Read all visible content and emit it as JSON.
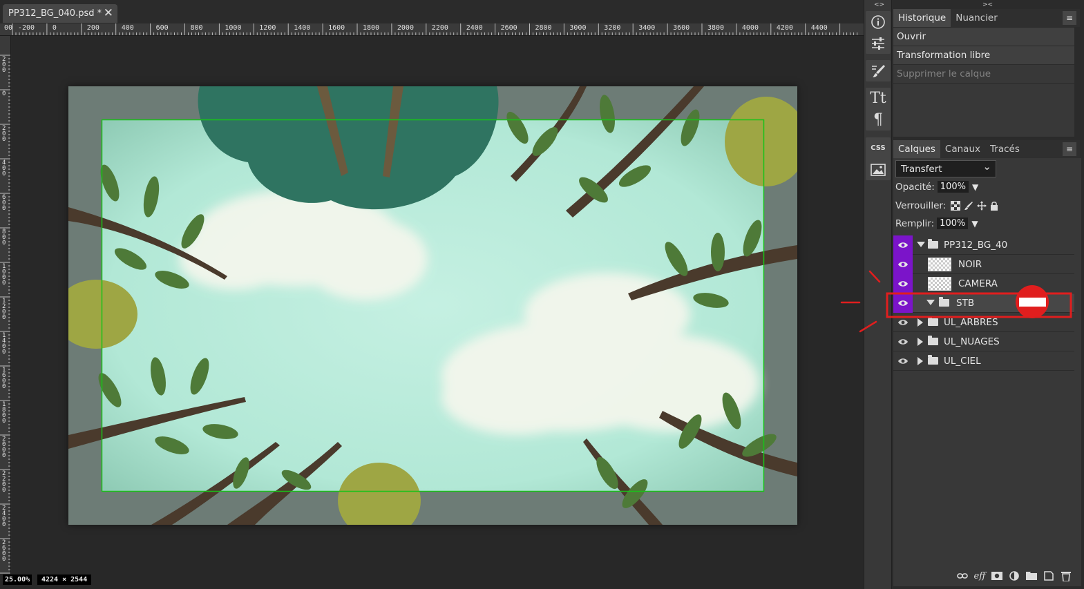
{
  "document_tab": {
    "title": "PP312_BG_040.psd *",
    "close_glyph": "✕"
  },
  "ruler_h": [
    "00",
    "-200",
    "0",
    "200",
    "400",
    "600",
    "800",
    "1000",
    "1200",
    "1400",
    "1600",
    "1800",
    "2000",
    "2200",
    "2400",
    "2600",
    "2800",
    "3000",
    "3200",
    "3400",
    "3600",
    "3800",
    "4000",
    "4200",
    "4400"
  ],
  "ruler_v": [
    "200",
    "0",
    "200",
    "400",
    "600",
    "800",
    "1000",
    "1200",
    "1400",
    "1600",
    "1800",
    "2000",
    "2200",
    "2400",
    "2600"
  ],
  "status": {
    "zoom": "25.00%",
    "dimensions": "4224 × 2544"
  },
  "tool_strip": {
    "collapse_glyph": "<>",
    "tools": [
      "info-icon",
      "adjustments-icon",
      "brush-settings-icon",
      "character-icon",
      "paragraph-icon",
      "css-icon",
      "image-icon"
    ],
    "css_label": "CSS"
  },
  "history_panel": {
    "collapse_glyph": "><",
    "tabs": [
      "Historique",
      "Nuancier"
    ],
    "menu_glyph": "≡",
    "items": [
      {
        "label": "Ouvrir",
        "state": "done"
      },
      {
        "label": "Transformation libre",
        "state": "done"
      },
      {
        "label": "Supprimer le calque",
        "state": "undone"
      }
    ]
  },
  "layers_panel": {
    "tabs": [
      "Calques",
      "Canaux",
      "Tracés"
    ],
    "menu_glyph": "≡",
    "blend_mode": "Transfert",
    "opacity_label": "Opacité:",
    "opacity_value": "100%",
    "lock_label": "Verrouiller:",
    "fill_label": "Remplir:",
    "fill_value": "100%",
    "layers": [
      {
        "name": "PP312_BG_40",
        "type": "group",
        "expanded": true,
        "highlight": true
      },
      {
        "name": "NOIR",
        "type": "layer",
        "highlight": true
      },
      {
        "name": "CAMERA",
        "type": "layer",
        "highlight": true
      },
      {
        "name": "STB",
        "type": "group",
        "expanded": true,
        "highlight": true,
        "selected": true
      },
      {
        "name": "UL_ARBRES",
        "type": "group",
        "expanded": false,
        "highlight": false
      },
      {
        "name": "UL_NUAGES",
        "type": "group",
        "expanded": false,
        "highlight": false
      },
      {
        "name": "UL_CIEL",
        "type": "group",
        "expanded": false,
        "highlight": false
      }
    ],
    "footer_icons": [
      "link-icon",
      "effects-icon",
      "mask-icon",
      "adjustment-layer-icon",
      "new-group-icon",
      "new-layer-icon",
      "delete-icon"
    ],
    "effects_label": "eff"
  },
  "colors": {
    "accent_purple": "#7b14c9",
    "annotation_red": "#e01e1e",
    "guide_green": "#19c219",
    "sky": "#b8ecdb"
  }
}
